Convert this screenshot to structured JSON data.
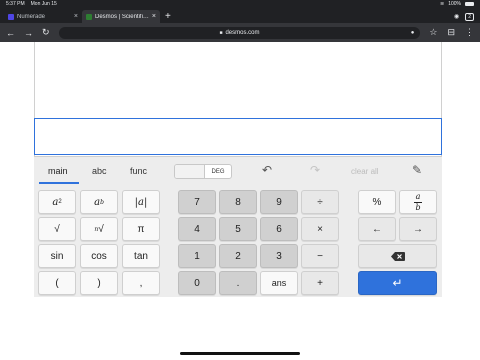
{
  "status_bar": {
    "time": "5:37 PM",
    "date": "Mon Jun 15",
    "battery": "100%"
  },
  "browser": {
    "tabs": [
      {
        "title": "Numerade",
        "favicon_color": "#4f46e5"
      },
      {
        "title": "Desmos | Scientific Calc",
        "favicon_color": "#2e7d32"
      }
    ],
    "tab_count": "2",
    "url": "desmos.com"
  },
  "keypad": {
    "tabs": [
      "main",
      "abc",
      "func"
    ],
    "active_tab": "main",
    "angle_mode": "DEG",
    "clear_all_label": "clear all",
    "accent_color": "#2f72dc",
    "keys": {
      "sqrt": "√",
      "abs": "|a|",
      "pi": "π",
      "sin": "sin",
      "cos": "cos",
      "tan": "tan",
      "lparen": "(",
      "rparen": ")",
      "comma": ",",
      "d7": "7",
      "d8": "8",
      "d9": "9",
      "d4": "4",
      "d5": "5",
      "d6": "6",
      "d1": "1",
      "d2": "2",
      "d3": "3",
      "d0": "0",
      "dot": ".",
      "ans": "ans",
      "divide": "÷",
      "times": "×",
      "minus": "−",
      "plus": "+",
      "percent": "%",
      "frac_a": "a",
      "frac_b": "b",
      "left": "←",
      "right": "→",
      "enter": "↵"
    }
  }
}
